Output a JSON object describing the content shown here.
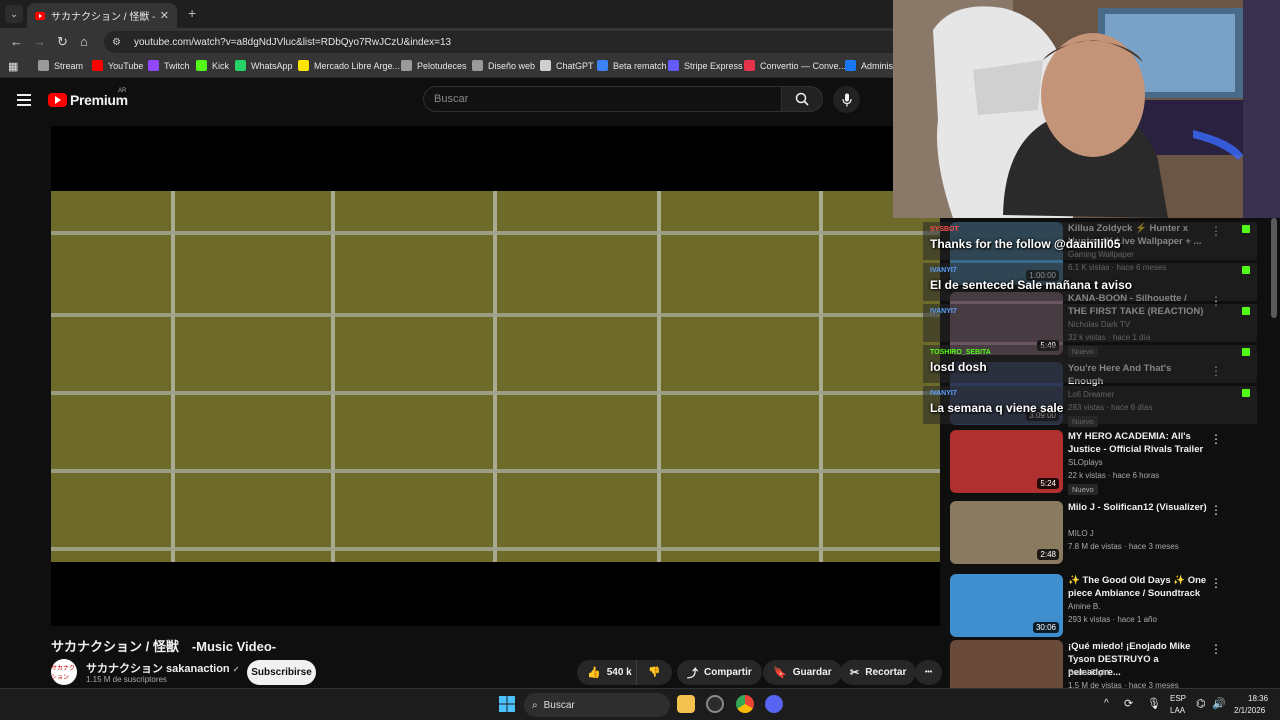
{
  "browser": {
    "tab_title": "サカナクション / 怪獣 -Music Vid",
    "close_glyph": "✕",
    "newtab_glyph": "+",
    "url": "youtube.com/watch?v=a8dgNdJVluc&list=RDbQyo7RwJCzU&index=13",
    "bookmarks": [
      {
        "label": "Stream",
        "color": "#9a9a9a"
      },
      {
        "label": "YouTube",
        "color": "#ff0000"
      },
      {
        "label": "Twitch",
        "color": "#9146ff"
      },
      {
        "label": "Kick",
        "color": "#53fc18"
      },
      {
        "label": "WhatsApp",
        "color": "#25d366"
      },
      {
        "label": "Mercado Libre Arge...",
        "color": "#ffe600"
      },
      {
        "label": "Pelotudeces",
        "color": "#9a9a9a"
      },
      {
        "label": "Diseño web",
        "color": "#9a9a9a"
      },
      {
        "label": "ChatGPT",
        "color": "#cfcfcf"
      },
      {
        "label": "Beta rematch",
        "color": "#3b82f6"
      },
      {
        "label": "Stripe Express",
        "color": "#635bff"
      },
      {
        "label": "Convertio — Conve...",
        "color": "#e5334b"
      },
      {
        "label": "Administ",
        "color": "#1877f2"
      }
    ]
  },
  "youtube": {
    "logo_text": "Premium",
    "logo_region": "AR",
    "search_placeholder": "Buscar"
  },
  "video": {
    "title": "サカナクション / 怪獣　-Music Video-",
    "channel_avatar_text": "サカナクション",
    "channel_name": "サカナクション sakanaction",
    "verified_glyph": "✓",
    "subscribers": "1.15 M de suscriptores",
    "subscribe_label": "Subscribirse",
    "likes": "540 k",
    "share_label": "Compartir",
    "save_label": "Guardar",
    "clip_label": "Recortar",
    "more_glyph": "•••"
  },
  "recommendations": [
    {
      "title": "Killua Zoldyck ⚡ Hunter x Hunter 4K Live Wallpaper + ...",
      "channel": "Gaming Wallpaper",
      "meta": "6.1 K vistas · hace 6 meses",
      "duration": "1:00:00",
      "badge": "",
      "thumb": "#3a6a8a"
    },
    {
      "title": "KANA-BOON - Silhouette / THE FIRST TAKE (REACTION)",
      "channel": "Nicholas Dark TV",
      "meta": "32 k vistas · hace 1 día",
      "duration": "5:49",
      "badge": "Nuevo",
      "thumb": "#6a5560"
    },
    {
      "title": "You're Here And That's Enough",
      "channel": "Lofi Dreamer",
      "meta": "283 vistas · hace 6 días",
      "duration": "3:09:00",
      "badge": "Nuevo",
      "thumb": "#2e3a5a"
    },
    {
      "title": "MY HERO ACADEMIA: All's Justice - Official Rivals Trailer",
      "channel": "SLOplays",
      "meta": "22 k vistas · hace 6 horas",
      "duration": "5:24",
      "badge": "Nuevo",
      "thumb": "#b03030"
    },
    {
      "title": "Milo J - Solifican12 (Visualizer)",
      "channel": "MILO J",
      "meta": "7.8 M de vistas · hace 3 meses",
      "duration": "2:48",
      "badge": "",
      "thumb": "#8a7a60"
    },
    {
      "title": "✨ The Good Old Days ✨ One piece Ambiance / Soundtrack",
      "channel": "Amine B.",
      "meta": "293 k vistas · hace 1 año",
      "duration": "30:06",
      "badge": "",
      "thumb": "#3f8fcf"
    },
    {
      "title": "¡Qué miedo! ¡Enojado Mike Tyson DESTRUYO a peleadore...",
      "channel": "Brutal Fight",
      "meta": "1.5 M de vistas · hace 3 meses",
      "duration": "",
      "badge": "",
      "thumb": "#6a4a3a"
    }
  ],
  "chat": [
    {
      "user": "SYSBOT",
      "text": "Thanks for the follow @daanilil05",
      "user_color": "#ff4d4d"
    },
    {
      "user": "IVANYI7",
      "text": "El de senteced Sale mañana t aviso",
      "user_color": "#5aa0ff"
    },
    {
      "user": "IVANYI7",
      "text": "",
      "user_color": "#5aa0ff"
    },
    {
      "user": "TOSHIRO_SEBITA",
      "text": "losd dosh",
      "user_color": "#53fc18"
    },
    {
      "user": "IVANYI7",
      "text": "La semana q viene sale",
      "user_color": "#5aa0ff"
    }
  ],
  "taskbar": {
    "search_label": "Buscar",
    "lang_top": "ESP",
    "lang_bottom": "LAA",
    "time": "18:36",
    "date": "2/1/2026"
  }
}
